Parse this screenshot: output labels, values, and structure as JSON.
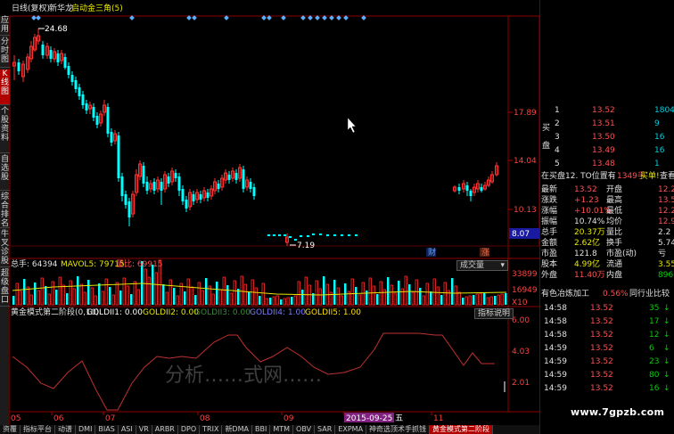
{
  "header": {
    "period": "日线(复权)",
    "stock_name": "新华龙",
    "formula": "启动金三角(5)"
  },
  "left_tabs": [
    {
      "label": "应用",
      "active": false
    },
    {
      "label": "分时图",
      "active": false
    },
    {
      "label": "K线图",
      "active": true
    },
    {
      "label": "个股资料",
      "active": false
    },
    {
      "label": "自选股",
      "active": false
    },
    {
      "label": "综合排名",
      "active": false
    },
    {
      "label": "牛叉诊股",
      "active": false
    },
    {
      "label": "超级盘口",
      "active": false
    }
  ],
  "price_axis": {
    "labels": [
      "17.89",
      "14.04",
      "10.13"
    ],
    "current_price_tag": "8.07"
  },
  "annotations": {
    "high_label": "24.68",
    "low_label": "7.19",
    "finance_marker": "财",
    "event_marker": "涨"
  },
  "volume_panel": {
    "total_volume_label": "总手: 64394",
    "mavol_label": "MAVOL5: 79715",
    "volume_ratio_label": "量比: 69915",
    "select_label": "成交量",
    "axis": [
      "33899",
      "16949"
    ],
    "unit": "X10"
  },
  "indicator_panel": {
    "name": "黄金模式第二阶段(0,10)",
    "lines": [
      {
        "label": "GOLDII1: 0.00",
        "color": "#ffffff"
      },
      {
        "label": "GOLDII2: 0.00",
        "color": "#e8e800"
      },
      {
        "label": "GOLDII3: 0.00",
        "color": "#3a8a3a"
      },
      {
        "label": "GOLDII4: 1.00",
        "color": "#7a7aff"
      },
      {
        "label": "GOLDII5: 1.00",
        "color": "#ffe000"
      }
    ],
    "help_button": "指标说明",
    "axis": [
      "6.00",
      "4.03",
      "2.01"
    ],
    "watermark": "分析……式网……"
  },
  "date_axis": {
    "labels": [
      "05",
      "06",
      "07",
      "08",
      "09",
      "2015-09-25 五",
      "11"
    ]
  },
  "bottom_tabs": [
    {
      "label": "资覆",
      "active": false
    },
    {
      "label": "指标平台",
      "active": false
    },
    {
      "label": "动谱",
      "active": false
    },
    {
      "label": "DMI",
      "active": false
    },
    {
      "label": "BIAS",
      "active": false
    },
    {
      "label": "ASI",
      "active": false
    },
    {
      "label": "VR",
      "active": false
    },
    {
      "label": "ARBR",
      "active": false
    },
    {
      "label": "DPO",
      "active": false
    },
    {
      "label": "TRIX",
      "active": false
    },
    {
      "label": "新DMA",
      "active": false
    },
    {
      "label": "BBI",
      "active": false
    },
    {
      "label": "MTM",
      "active": false
    },
    {
      "label": "OBV",
      "active": false
    },
    {
      "label": "SAR",
      "active": false
    },
    {
      "label": "EXPMA",
      "active": false
    },
    {
      "label": "神奇选顶术手抓钱",
      "active": false
    },
    {
      "label": "黄金模式第二阶段",
      "active": true
    }
  ],
  "quote_panel": {
    "order_book": [
      {
        "level": "1",
        "price": "13.52",
        "volume": "1804"
      },
      {
        "level": "2",
        "price": "13.51",
        "volume": "9"
      },
      {
        "level": "3",
        "price": "13.50",
        "volume": "16"
      },
      {
        "level": "4",
        "price": "13.49",
        "volume": "16"
      },
      {
        "level": "5",
        "price": "13.48",
        "volume": "1"
      }
    ],
    "buy_side_label": "买盘",
    "buy_info": {
      "text": "在买盘12. TO位置有",
      "volume": "1349手",
      "buy_label": "买单!",
      "view": "查看详"
    },
    "stats_left": [
      {
        "label": "最新",
        "value": "13.52",
        "color": "#ff5050"
      },
      {
        "label": "涨跌",
        "value": "+1.23",
        "color": "#ff5050"
      },
      {
        "label": "涨幅",
        "value": "+10.01%",
        "color": "#ff5050"
      },
      {
        "label": "振幅",
        "value": "10.74%",
        "color": "#e0e0e0"
      },
      {
        "label": "总手",
        "value": "20.37万",
        "color": "#e8e800"
      },
      {
        "label": "金额",
        "value": "2.62亿",
        "color": "#e8e800"
      },
      {
        "label": "市盈",
        "value": "121.8",
        "color": "#e0e0e0"
      },
      {
        "label": "股本",
        "value": "4.99亿",
        "color": "#e8e800"
      },
      {
        "label": "外盘",
        "value": "11.40万",
        "color": "#ff5050"
      }
    ],
    "stats_right": [
      {
        "label": "开盘",
        "value": "12.2",
        "color": "#ff5050"
      },
      {
        "label": "最高",
        "value": "13.5",
        "color": "#ff5050"
      },
      {
        "label": "最低",
        "value": "12.2",
        "color": "#ff5050"
      },
      {
        "label": "均价",
        "value": "12.9",
        "color": "#ff5050"
      },
      {
        "label": "量比",
        "value": "2.2",
        "color": "#e0e0e0"
      },
      {
        "label": "换手",
        "value": "5.74",
        "color": "#e0e0e0"
      },
      {
        "label": "市盈(动)",
        "value": "亏",
        "color": "#e0e0e0"
      },
      {
        "label": "流通",
        "value": "3.55",
        "color": "#e8e800"
      },
      {
        "label": "内盘",
        "value": "896",
        "color": "#00d000"
      }
    ],
    "sector": {
      "name": "有色冶炼加工",
      "change": "0.56%",
      "compare": "同行业比较"
    },
    "ticks": [
      {
        "time": "14:58",
        "price": "13.52",
        "volume": "35"
      },
      {
        "time": "14:58",
        "price": "13.52",
        "volume": "17"
      },
      {
        "time": "14:58",
        "price": "13.52",
        "volume": "12"
      },
      {
        "time": "14:59",
        "price": "13.52",
        "volume": "6"
      },
      {
        "time": "14:59",
        "price": "13.52",
        "volume": "23"
      },
      {
        "time": "14:59",
        "price": "13.52",
        "volume": "80"
      },
      {
        "time": "14:59",
        "price": "13.52",
        "volume": "16"
      }
    ]
  },
  "watermark_site": "www.7gpzb.com",
  "colors": {
    "up": "#ff3030",
    "down": "#00ffff",
    "border": "#8b0000",
    "panel_bg": "#000000",
    "gold": "#e8e800",
    "ma": "#e8e800"
  }
}
